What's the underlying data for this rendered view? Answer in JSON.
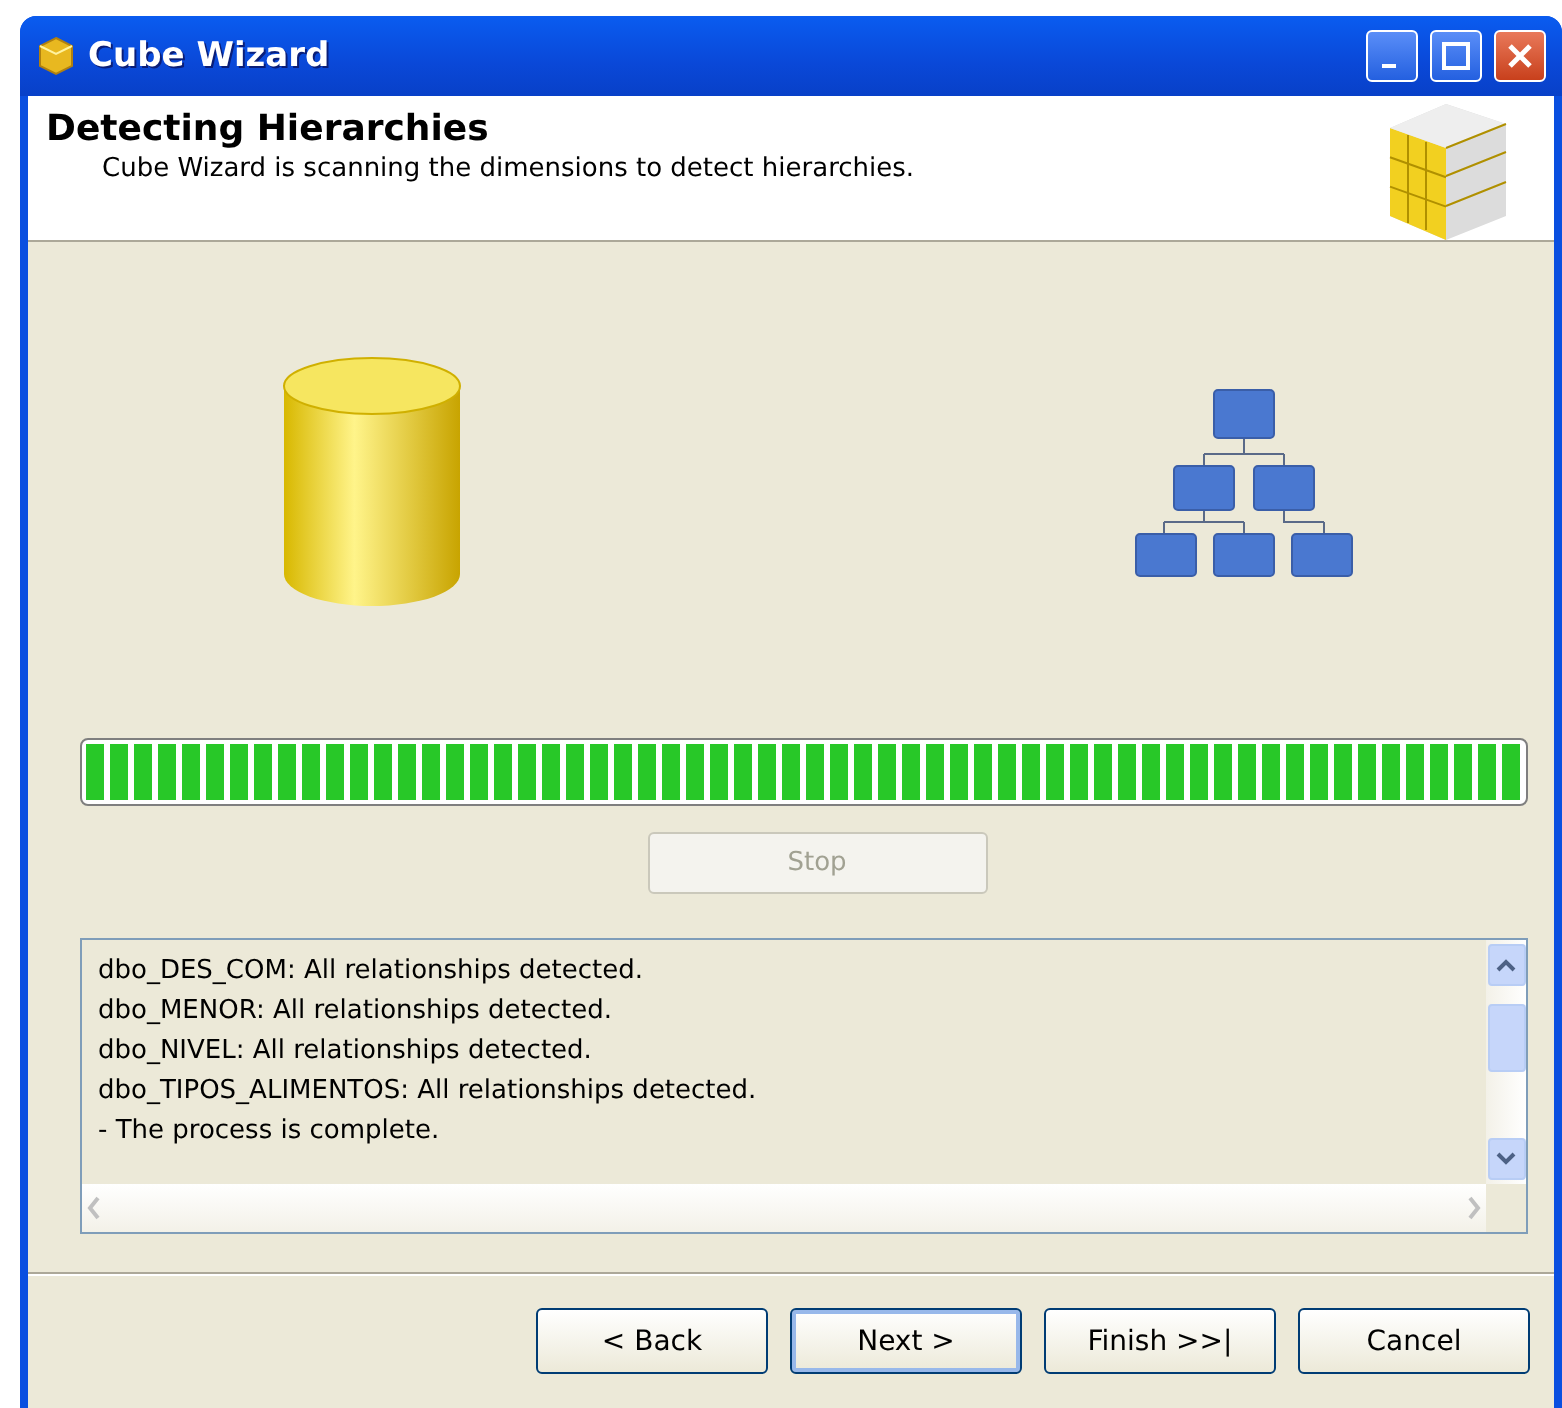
{
  "window": {
    "title": "Cube Wizard"
  },
  "header": {
    "title": "Detecting Hierarchies",
    "subtitle": "Cube Wizard is scanning the dimensions to detect hierarchies."
  },
  "progress": {
    "level": 1
  },
  "stop_button": {
    "label": "Stop",
    "disabled": true
  },
  "log": {
    "lines": [
      "dbo_DES_COM: All relationships detected.",
      "dbo_MENOR: All relationships detected.",
      "dbo_NIVEL: All relationships detected.",
      "dbo_TIPOS_ALIMENTOS: All relationships detected.",
      "- The process is complete."
    ]
  },
  "buttons": [
    {
      "label": "< Back",
      "default": false
    },
    {
      "label": "Next >",
      "default": true
    },
    {
      "label": "Finish >>|",
      "default": false
    },
    {
      "label": "Cancel",
      "default": false
    }
  ]
}
